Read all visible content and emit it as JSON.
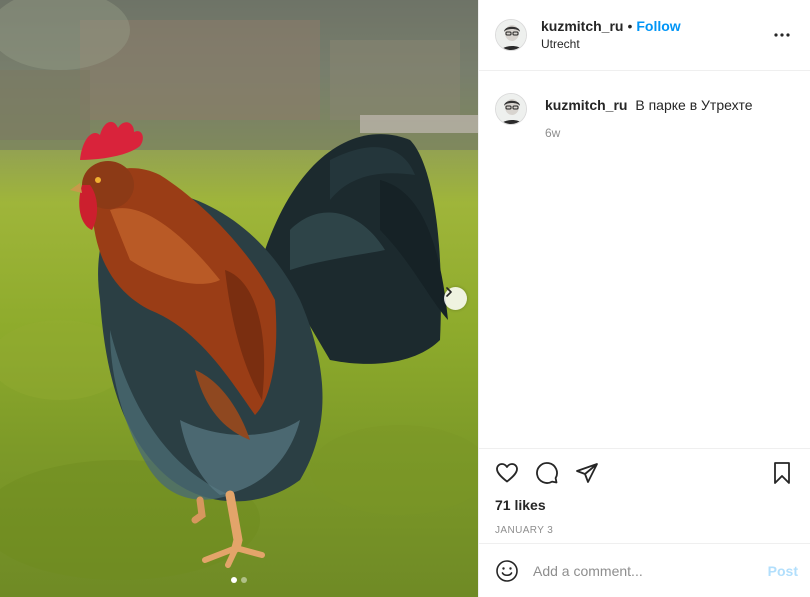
{
  "post": {
    "author": {
      "username": "kuzmitch_ru",
      "follow_label": "Follow",
      "separator": "•",
      "location": "Utrecht"
    },
    "caption": {
      "username": "kuzmitch_ru",
      "text": "В парке в Утрехте",
      "time": "6w"
    },
    "likes": "71 likes",
    "date": "JANUARY 3",
    "comment_placeholder": "Add a comment...",
    "post_label": "Post",
    "carousel": {
      "count": 2,
      "active_index": 0
    }
  },
  "icons": {
    "more": "more-options-icon",
    "like": "heart-icon",
    "comment": "comment-icon",
    "share": "paper-plane-icon",
    "save": "bookmark-icon",
    "emoji": "smiley-icon",
    "next": "chevron-right-icon"
  },
  "colors": {
    "accent": "#0095f6",
    "post_disabled": "#b2dffc",
    "muted": "#8e8e8e",
    "border": "#efefef"
  }
}
